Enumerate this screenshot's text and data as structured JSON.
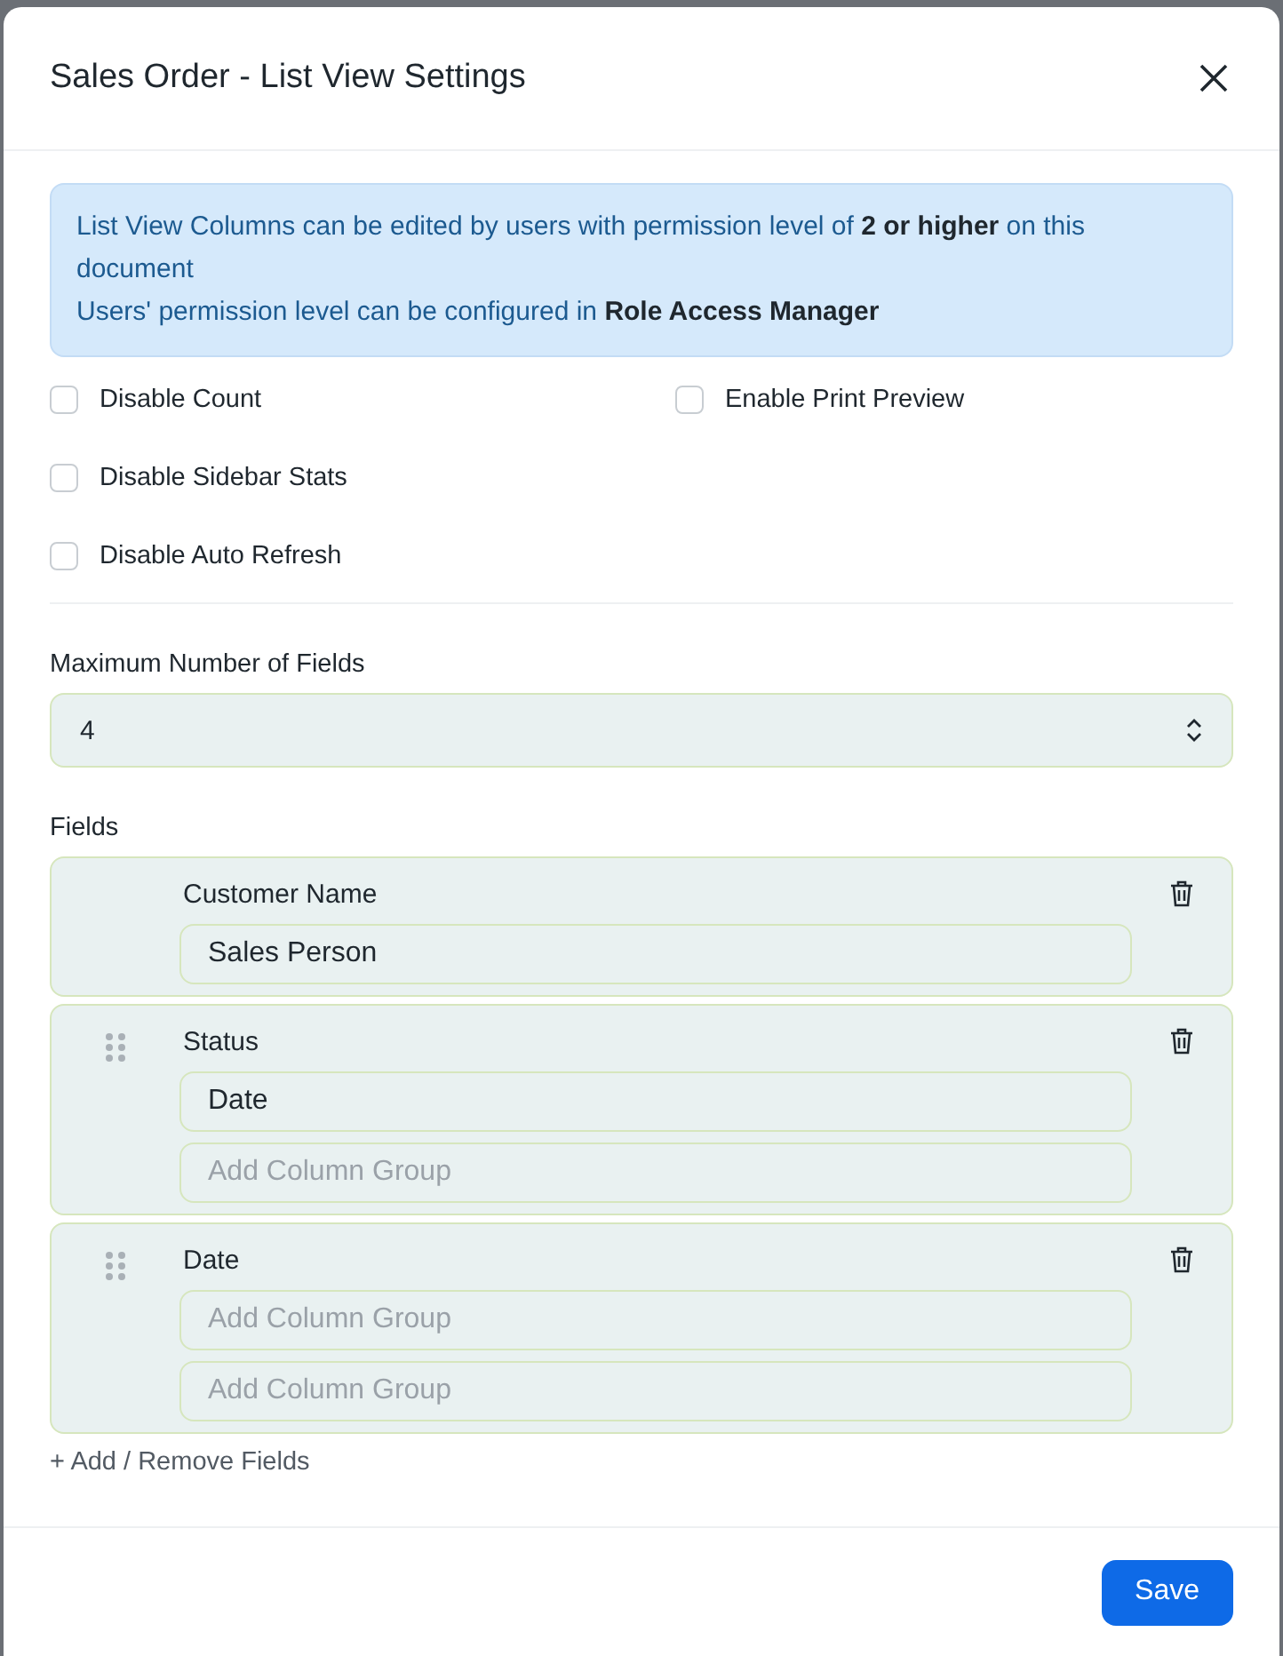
{
  "dialog": {
    "title": "Sales Order - List View Settings"
  },
  "notice": {
    "lines": [
      "List View Columns can be edited by users with permission level of **2 or higher** on this document",
      "Users' permission level can be configured in **Role Access Manager**"
    ]
  },
  "option_groups": [
    {
      "items": [
        {
          "label": "Disable Count",
          "checked": false
        },
        {
          "label": "Disable Sidebar Stats",
          "checked": false
        },
        {
          "label": "Disable Auto Refresh",
          "checked": false
        }
      ]
    },
    {
      "items": [
        {
          "label": "Enable Print Preview",
          "checked": false
        }
      ]
    }
  ],
  "max_fields": {
    "label": "Maximum Number of Fields",
    "value": "4"
  },
  "fields": {
    "label": "Fields",
    "items": [
      {
        "name": "Customer Name",
        "draggable": false,
        "groups": [
          {
            "value": "Sales Person"
          }
        ]
      },
      {
        "name": "Status",
        "draggable": true,
        "groups": [
          {
            "value": "Date"
          },
          {
            "placeholder": "Add Column Group"
          }
        ]
      },
      {
        "name": "Date",
        "draggable": true,
        "groups": [
          {
            "placeholder": "Add Column Group"
          },
          {
            "placeholder": "Add Column Group"
          }
        ]
      }
    ],
    "add_link": "+ Add / Remove Fields"
  },
  "buttons": [
    {
      "label": "Save"
    }
  ]
}
